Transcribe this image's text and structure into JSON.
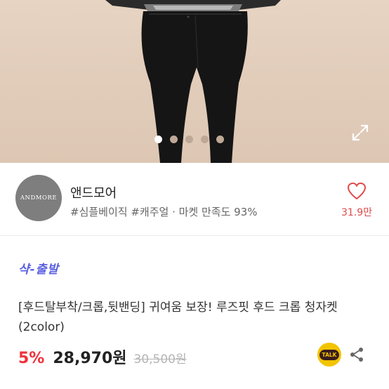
{
  "hero": {
    "image_desc_icon": "product-photo",
    "carousel_total": 5,
    "carousel_active": 1,
    "expand_icon": "expand-icon"
  },
  "seller": {
    "logo_text": "ANDMORE",
    "name": "앤드모어",
    "tags": "#심플베이직 #캐주얼 · 마켓 만족도 93%",
    "like_count": "31.9만"
  },
  "product": {
    "badge": "샥-출발",
    "title": "[후드탈부착/크롭,뒷밴딩] 귀여움 보장! 루즈핏 후드 크롭 청자켓 (2color)",
    "discount": "5%",
    "price": "28,970원",
    "original_price": "30,500원",
    "talk_label": "TALK"
  },
  "colors": {
    "discount": "#f0303a",
    "badge": "#5a5fe0",
    "like": "#e04a4a",
    "talk_bg": "#f2c400"
  }
}
